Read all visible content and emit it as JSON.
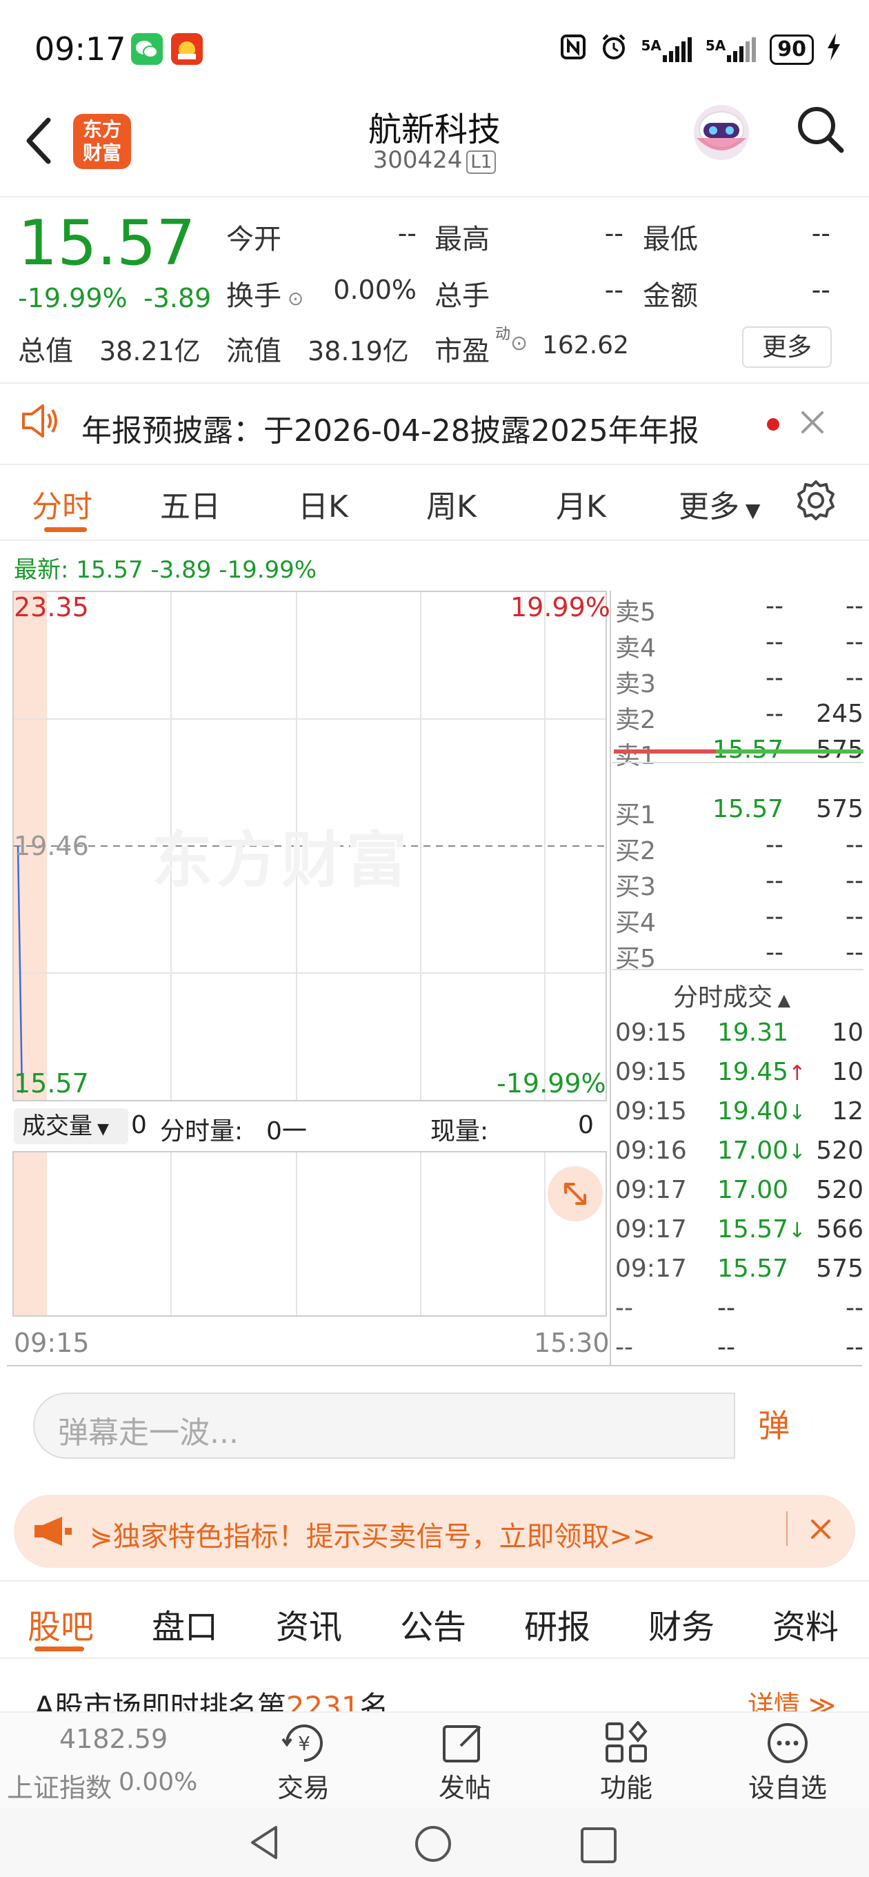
{
  "status_bar": {
    "time": "09:17",
    "battery": "90",
    "network_1": "5A",
    "network_2": "5A"
  },
  "header": {
    "logo_text": "东方\n财富",
    "title": "航新科技",
    "code": "300424",
    "level": "L1"
  },
  "quote": {
    "price": "15.57",
    "change_pct": "-19.99%",
    "change": "-3.89",
    "rows": [
      [
        {
          "label": "今开",
          "value": "--"
        },
        {
          "label": "最高",
          "value": "--"
        },
        {
          "label": "最低",
          "value": "--"
        }
      ],
      [
        {
          "label": "换手",
          "value": "0.00%"
        },
        {
          "label": "总手",
          "value": "--"
        },
        {
          "label": "金额",
          "value": "--"
        }
      ]
    ],
    "total_value_label": "总值",
    "total_value": "38.21亿",
    "float_value_label": "流值",
    "float_value": "38.19亿",
    "pe_label": "市盈",
    "pe_sup": "动",
    "pe_value": "162.62",
    "more_button": "更多"
  },
  "notice": {
    "text": "年报预披露：于2026-04-28披露2025年年报"
  },
  "chart_tabs": [
    "分时",
    "五日",
    "日K",
    "周K",
    "月K",
    "更多"
  ],
  "latest_line": "最新: 15.57 -3.89 -19.99%",
  "chart": {
    "y_top": "23.35",
    "y_mid": "19.46",
    "y_bottom": "15.57",
    "pct_top": "19.99%",
    "pct_bottom": "-19.99%",
    "watermark": "东方财富",
    "x_start": "09:15",
    "x_end": "15:30",
    "vol_selector": "成交量",
    "vol_value": "0",
    "vol_fenshi_label": "分时量:",
    "vol_fenshi_value": "0一",
    "vol_now_label": "现量:",
    "vol_now_value": "0"
  },
  "chart_data": {
    "type": "line",
    "x": [
      "09:15",
      "09:15"
    ],
    "values": [
      19.46,
      15.57
    ],
    "ylim": [
      15.57,
      23.35
    ]
  },
  "order_book": {
    "sell": [
      {
        "label": "卖5",
        "price": "--",
        "vol": "--"
      },
      {
        "label": "卖4",
        "price": "--",
        "vol": "--"
      },
      {
        "label": "卖3",
        "price": "--",
        "vol": "--"
      },
      {
        "label": "卖2",
        "price": "--",
        "vol": "245"
      },
      {
        "label": "卖1",
        "price": "15.57",
        "vol": "575"
      }
    ],
    "buy": [
      {
        "label": "买1",
        "price": "15.57",
        "vol": "575"
      },
      {
        "label": "买2",
        "price": "--",
        "vol": "--"
      },
      {
        "label": "买3",
        "price": "--",
        "vol": "--"
      },
      {
        "label": "买4",
        "price": "--",
        "vol": "--"
      },
      {
        "label": "买5",
        "price": "--",
        "vol": "--"
      }
    ],
    "trades_title": "分时成交",
    "trades": [
      {
        "time": "09:15",
        "price": "19.31",
        "arrow": "",
        "vol": "10"
      },
      {
        "time": "09:15",
        "price": "19.45",
        "arrow": "↑",
        "vol": "10"
      },
      {
        "time": "09:15",
        "price": "19.40",
        "arrow": "↓",
        "vol": "12"
      },
      {
        "time": "09:16",
        "price": "17.00",
        "arrow": "↓",
        "vol": "520"
      },
      {
        "time": "09:17",
        "price": "17.00",
        "arrow": "",
        "vol": "520"
      },
      {
        "time": "09:17",
        "price": "15.57",
        "arrow": "↓",
        "vol": "566"
      },
      {
        "time": "09:17",
        "price": "15.57",
        "arrow": "",
        "vol": "575"
      },
      {
        "time": "--",
        "price": "--",
        "arrow": "",
        "vol": "--"
      },
      {
        "time": "--",
        "price": "--",
        "arrow": "",
        "vol": "--"
      }
    ]
  },
  "danmu": {
    "placeholder": "弹幕走一波...",
    "button": "弹"
  },
  "promo": {
    "text": "⋟独家特色指标！提示买卖信号，立即领取>>"
  },
  "bottom_tabs": [
    "股吧",
    "盘口",
    "资讯",
    "公告",
    "研报",
    "财务",
    "资料"
  ],
  "rank": {
    "prefix": "A股市场即时排名第",
    "number": "2231",
    "suffix": "名",
    "detail": "详情 ≫"
  },
  "bottom_bar": {
    "index_value": "4182.59",
    "index_name": "上证指数",
    "index_change": "0.00%",
    "items": [
      "交易",
      "发帖",
      "功能",
      "设自选"
    ]
  }
}
